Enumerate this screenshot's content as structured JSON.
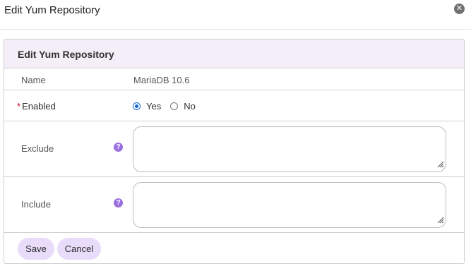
{
  "dialog": {
    "title": "Edit Yum Repository",
    "close_icon": "close-circle-icon"
  },
  "panel": {
    "title": "Edit Yum Repository",
    "name": {
      "label": "Name",
      "value": "MariaDB 10.6"
    },
    "enabled": {
      "required_mark": "*",
      "label": "Enabled",
      "options": [
        "Yes",
        "No"
      ],
      "selected": "Yes"
    },
    "exclude": {
      "label": "Exclude",
      "value": "",
      "help_icon": "question-circle-icon"
    },
    "include": {
      "label": "Include",
      "value": "",
      "help_icon": "question-circle-icon"
    },
    "buttons": {
      "save": "Save",
      "cancel": "Cancel"
    }
  },
  "colors": {
    "panel_header_bg": "#f3eef8",
    "button_bg": "#e8dcfa",
    "help_icon": "#9a6fe0",
    "radio_checked": "#1565d8",
    "required": "#d0021b"
  }
}
